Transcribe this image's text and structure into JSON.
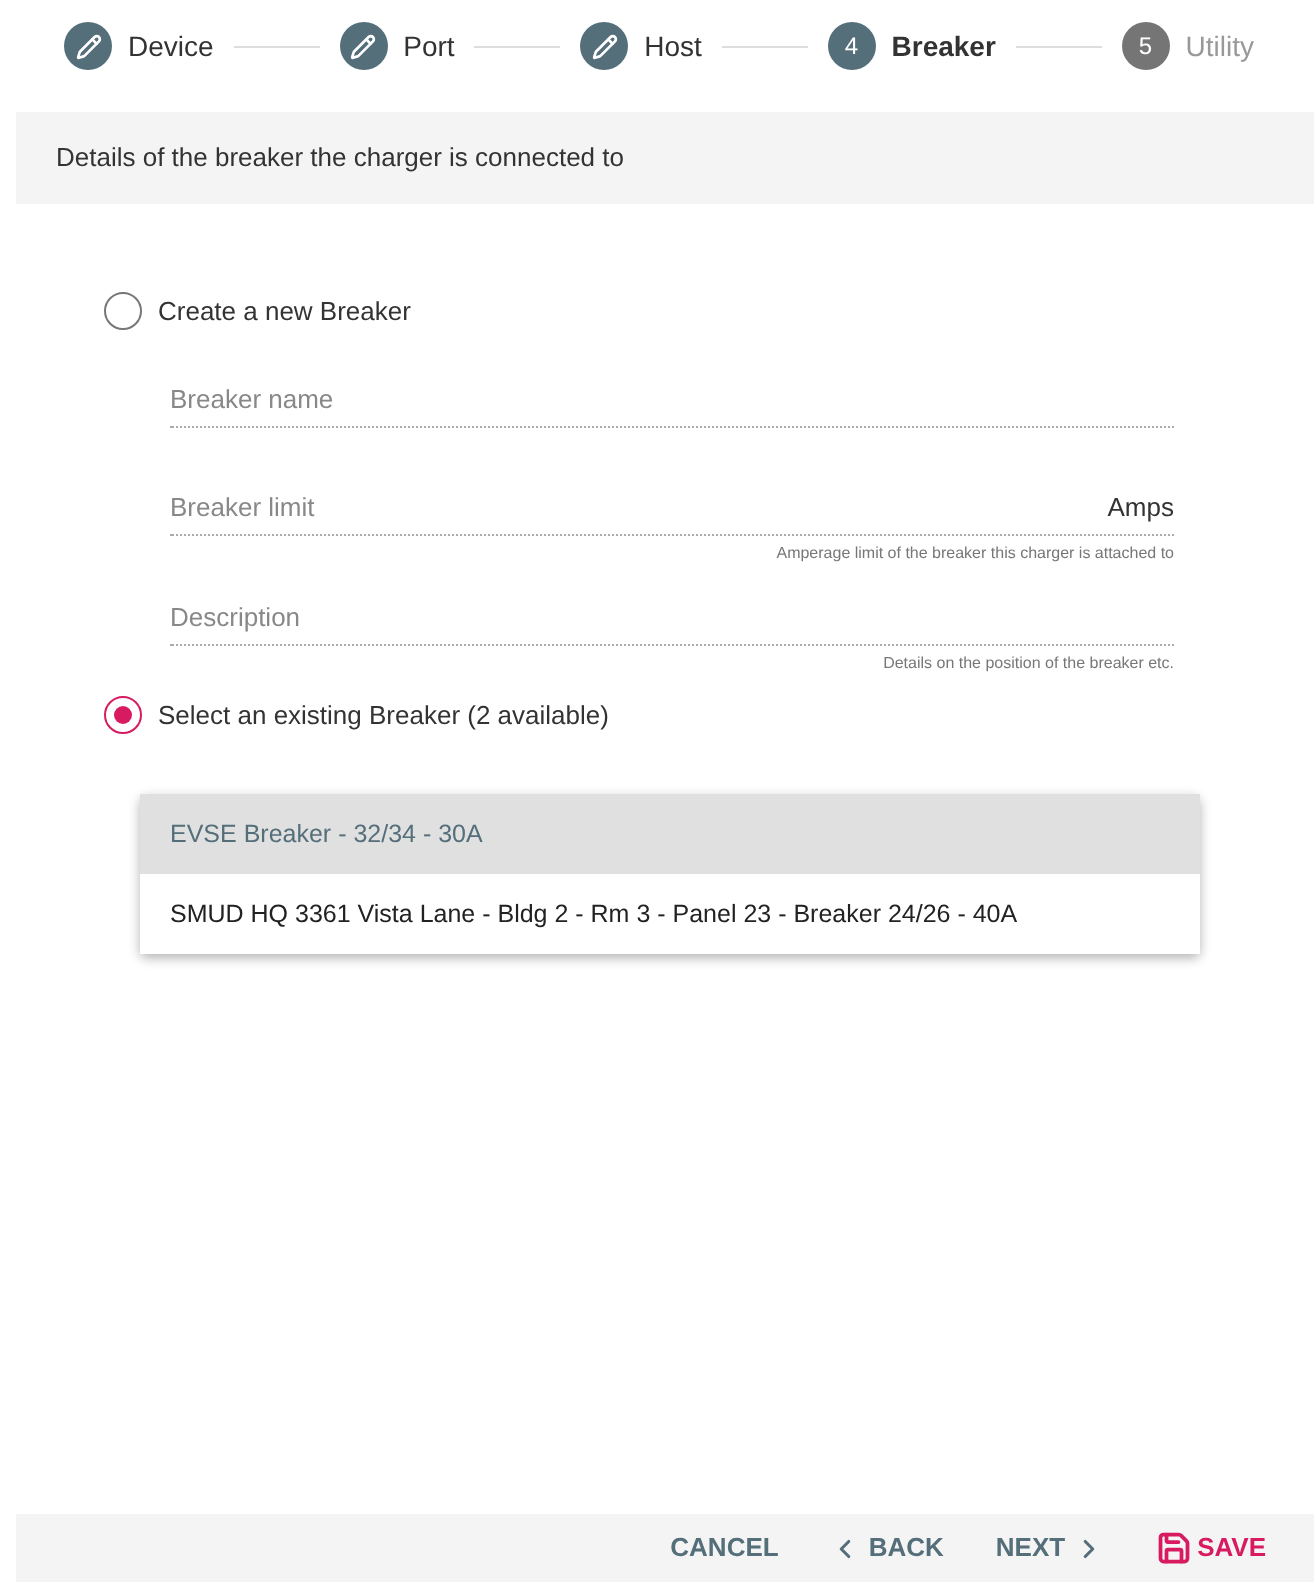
{
  "steps": [
    {
      "label": "Device",
      "kind": "done"
    },
    {
      "label": "Port",
      "kind": "done"
    },
    {
      "label": "Host",
      "kind": "done"
    },
    {
      "label": "Breaker",
      "kind": "active",
      "number": "4"
    },
    {
      "label": "Utility",
      "kind": "pending",
      "number": "5"
    }
  ],
  "section_header": "Details of the breaker the charger is connected to",
  "options": [
    {
      "label": "Create a new Breaker",
      "selected": false
    },
    {
      "label": "Select an existing Breaker (2 available)",
      "selected": true
    }
  ],
  "fields": [
    {
      "placeholder": "Breaker name"
    },
    {
      "placeholder": "Breaker limit",
      "suffix": "Amps",
      "hint": "Amperage limit of the breaker this charger is attached to"
    },
    {
      "placeholder": "Description",
      "hint": "Details on the position of the breaker etc."
    }
  ],
  "breaker_menu": [
    {
      "label": "EVSE Breaker - 32/34 - 30A",
      "selected": true
    },
    {
      "label": "SMUD HQ 3361 Vista Lane - Bldg 2 - Rm 3 - Panel 23 - Breaker 24/26 - 40A",
      "selected": false
    }
  ],
  "footer": {
    "cancel": "CANCEL",
    "back": "BACK",
    "next": "NEXT",
    "save": "SAVE"
  }
}
